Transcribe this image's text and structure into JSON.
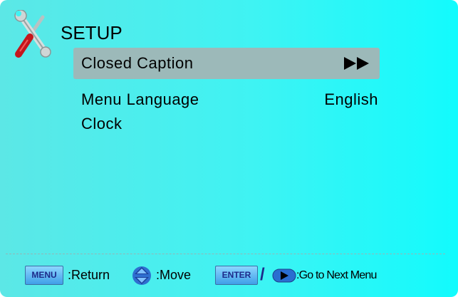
{
  "setup": {
    "title": "SETUP",
    "icon": "wrench-screwdriver-icon",
    "highlight_color": "#9cb9b9",
    "items": [
      {
        "label": "Closed Caption",
        "value": "",
        "icon": "forward-arrows-icon",
        "selected": true
      },
      {
        "label": "Menu Language",
        "value": "English",
        "selected": false
      },
      {
        "label": "Clock",
        "value": "",
        "selected": false
      }
    ]
  },
  "footer": {
    "menu_key": "MENU",
    "menu_hint": ":Return",
    "move_icon": "up-down-arrows-icon",
    "move_hint": ":Move",
    "enter_key": "ENTER",
    "separator": "/",
    "right_icon": "right-arrow-button-icon",
    "enter_hint": ":Go to Next Menu"
  }
}
